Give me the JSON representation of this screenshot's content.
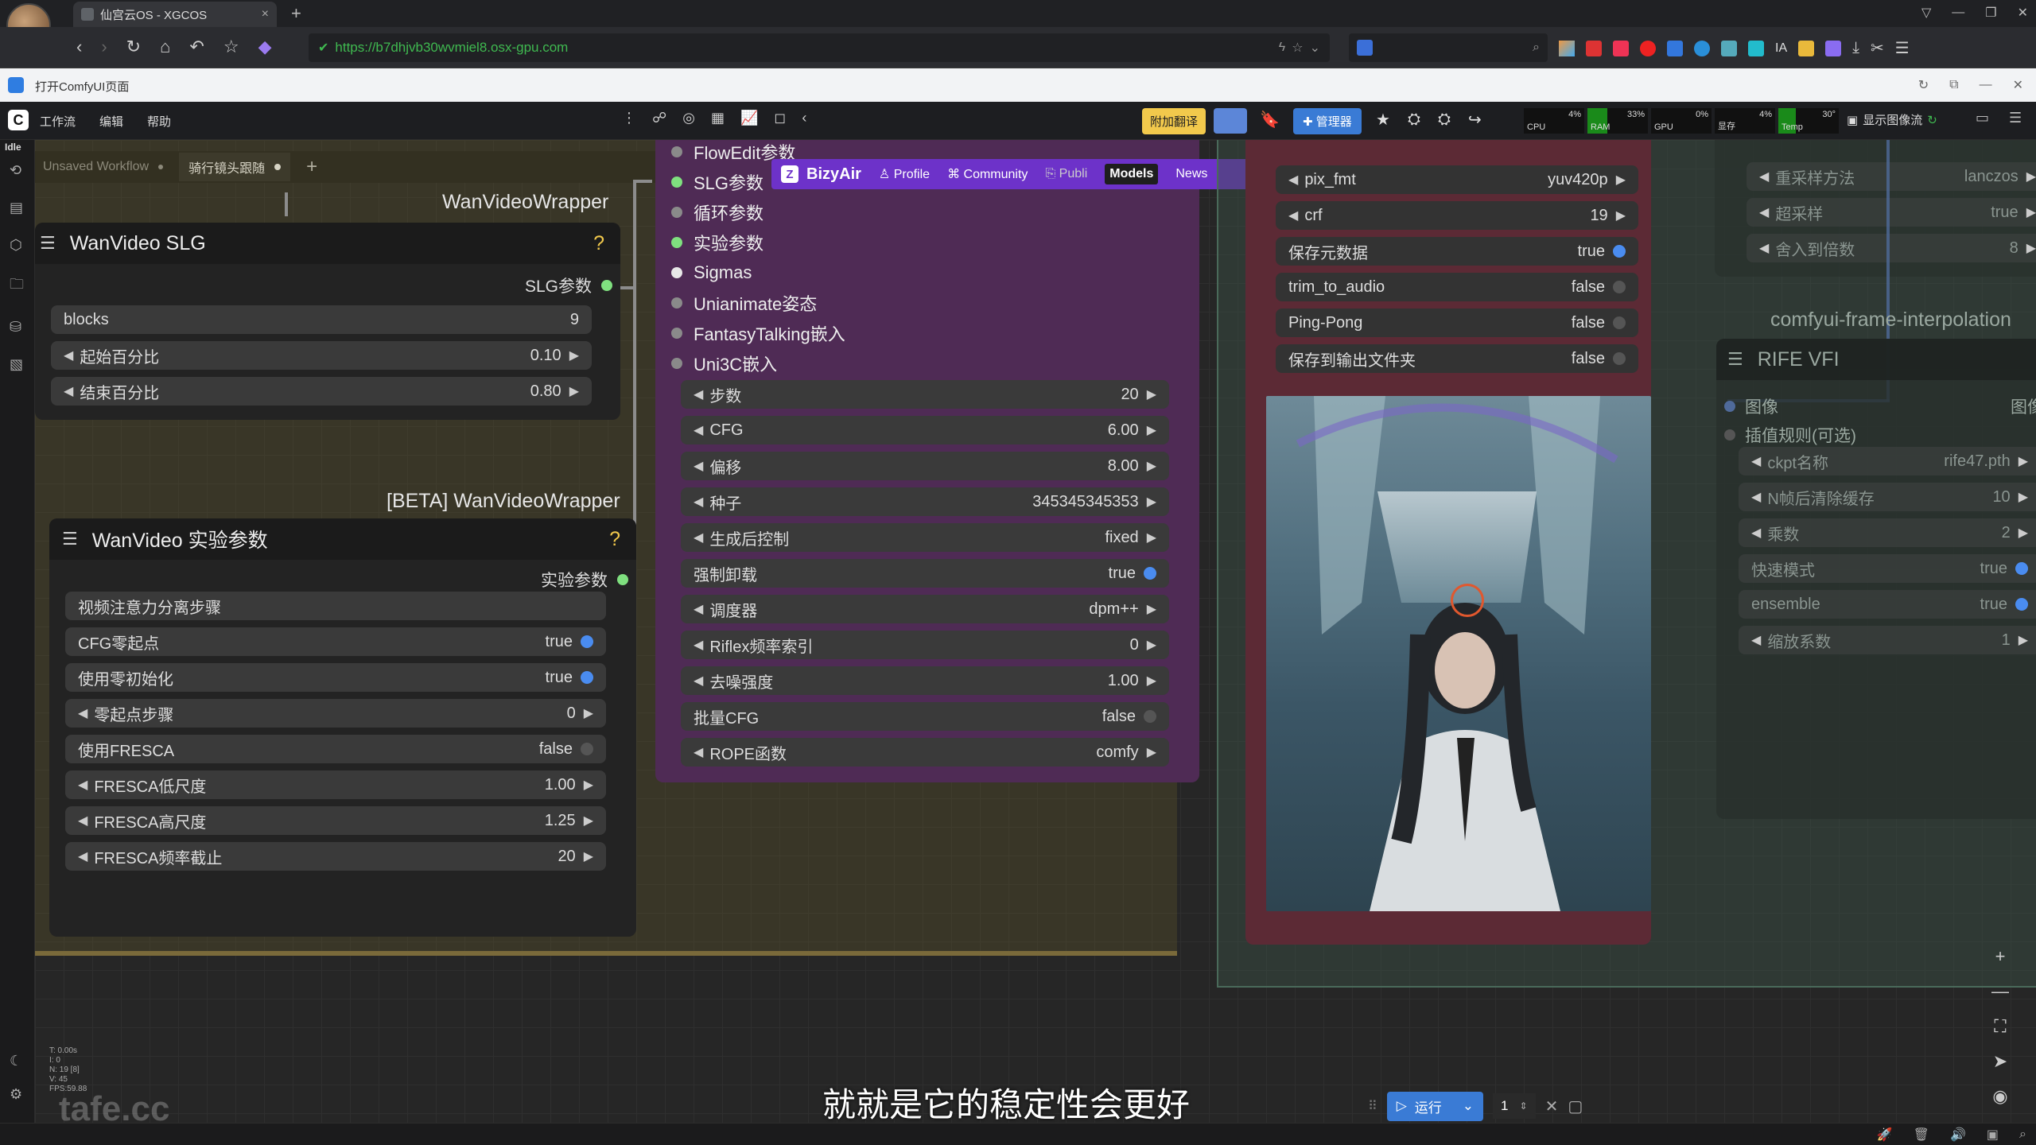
{
  "browser": {
    "tab_title": "仙宫云OS - XGCOS",
    "url": "https://b7dhjvb30wvmiel8.osx-gpu.com"
  },
  "app_bar": {
    "title": "打开ComfyUI页面"
  },
  "comfy": {
    "menu": [
      "工作流",
      "编辑",
      "帮助"
    ],
    "status": "Idle",
    "translate_label": "附加翻译",
    "manager_label": "管理器",
    "show_image_label": "显示图像流",
    "monitors": [
      {
        "name": "CPU",
        "value": "4%"
      },
      {
        "name": "RAM",
        "value": "33%"
      },
      {
        "name": "GPU",
        "value": "0%"
      },
      {
        "name": "显存",
        "value": "4%"
      },
      {
        "name": "Temp",
        "value": "30°"
      }
    ],
    "tabs": [
      {
        "label": "Unsaved Workflow"
      },
      {
        "label": "骑行镜头跟随"
      }
    ]
  },
  "bizyair": {
    "brand": "BizyAir",
    "profile": "Profile",
    "community": "Community",
    "publish": "Publi",
    "models": "Models",
    "news": "News"
  },
  "group_labels": {
    "wrapper1": "WanVideoWrapper",
    "wrapper2": "[BETA] WanVideoWrapper",
    "interp": "comfyui-frame-interpolation"
  },
  "slg_node": {
    "title": "WanVideo SLG",
    "output": "SLG参数",
    "rows": [
      {
        "label": "blocks",
        "value": "9",
        "kind": "text"
      },
      {
        "label": "起始百分比",
        "value": "0.10",
        "kind": "num"
      },
      {
        "label": "结束百分比",
        "value": "0.80",
        "kind": "num"
      }
    ]
  },
  "exp_node": {
    "title": "WanVideo 实验参数",
    "output": "实验参数",
    "rows": [
      {
        "label": "视频注意力分离步骤",
        "value": "",
        "kind": "text"
      },
      {
        "label": "CFG零起点",
        "value": "true",
        "kind": "bool_on"
      },
      {
        "label": "使用零初始化",
        "value": "true",
        "kind": "bool_on"
      },
      {
        "label": "零起点步骤",
        "value": "0",
        "kind": "num"
      },
      {
        "label": "使用FRESCA",
        "value": "false",
        "kind": "bool_off"
      },
      {
        "label": "FRESCA低尺度",
        "value": "1.00",
        "kind": "num"
      },
      {
        "label": "FRESCA高尺度",
        "value": "1.25",
        "kind": "num"
      },
      {
        "label": "FRESCA频率截止",
        "value": "20",
        "kind": "num"
      }
    ]
  },
  "sampler_node": {
    "inputs": [
      {
        "label": "FlowEdit参数",
        "color": "#8a8a8a"
      },
      {
        "label": "SLG参数",
        "color": "#7fe07f"
      },
      {
        "label": "循环参数",
        "color": "#8a8a8a"
      },
      {
        "label": "实验参数",
        "color": "#7fe07f"
      },
      {
        "label": "Sigmas",
        "color": "#e8e8e8"
      },
      {
        "label": "Unianimate姿态",
        "color": "#8a8a8a"
      },
      {
        "label": "FantasyTalking嵌入",
        "color": "#8a8a8a"
      },
      {
        "label": "Uni3C嵌入",
        "color": "#8a8a8a"
      }
    ],
    "rows": [
      {
        "label": "步数",
        "value": "20",
        "kind": "num"
      },
      {
        "label": "CFG",
        "value": "6.00",
        "kind": "num"
      },
      {
        "label": "偏移",
        "value": "8.00",
        "kind": "num"
      },
      {
        "label": "种子",
        "value": "345345345353",
        "kind": "num"
      },
      {
        "label": "生成后控制",
        "value": "fixed",
        "kind": "num"
      },
      {
        "label": "强制卸载",
        "value": "true",
        "kind": "bool_on"
      },
      {
        "label": "调度器",
        "value": "dpm++",
        "kind": "num"
      },
      {
        "label": "Riflex频率索引",
        "value": "0",
        "kind": "num"
      },
      {
        "label": "去噪强度",
        "value": "1.00",
        "kind": "num"
      },
      {
        "label": "批量CFG",
        "value": "false",
        "kind": "bool_off"
      },
      {
        "label": "ROPE函数",
        "value": "comfy",
        "kind": "num"
      }
    ]
  },
  "video_node": {
    "rows": [
      {
        "label": "pix_fmt",
        "value": "yuv420p",
        "kind": "num"
      },
      {
        "label": "crf",
        "value": "19",
        "kind": "num"
      },
      {
        "label": "保存元数据",
        "value": "true",
        "kind": "bool_on"
      },
      {
        "label": "trim_to_audio",
        "value": "false",
        "kind": "bool_off"
      },
      {
        "label": "Ping-Pong",
        "value": "false",
        "kind": "bool_off"
      },
      {
        "label": "保存到输出文件夹",
        "value": "false",
        "kind": "bool_off"
      }
    ]
  },
  "upscale_node": {
    "rows": [
      {
        "label": "重采样方法",
        "value": "lanczos"
      },
      {
        "label": "超采样",
        "value": "true"
      },
      {
        "label": "舍入到倍数",
        "value": "8"
      }
    ]
  },
  "rife_node": {
    "title": "RIFE VFI",
    "input_image": "图像",
    "output_image": "图像",
    "input_rule": "插值规则(可选)",
    "rows": [
      {
        "label": "ckpt名称",
        "value": "rife47.pth",
        "kind": "num"
      },
      {
        "label": "N帧后清除缓存",
        "value": "10",
        "kind": "num"
      },
      {
        "label": "乘数",
        "value": "2",
        "kind": "num"
      },
      {
        "label": "快速模式",
        "value": "true",
        "kind": "bool_on"
      },
      {
        "label": "ensemble",
        "value": "true",
        "kind": "bool_on"
      },
      {
        "label": "缩放系数",
        "value": "1",
        "kind": "num"
      }
    ]
  },
  "queue": {
    "run_label": "运行",
    "count": "1"
  },
  "stats": [
    "T: 0.00s",
    "I: 0",
    "N: 19 [8]",
    "V: 45",
    "FPS:59.88"
  ],
  "subtitle": "就就是它的稳定性会更好",
  "watermark": "tafe.cc"
}
